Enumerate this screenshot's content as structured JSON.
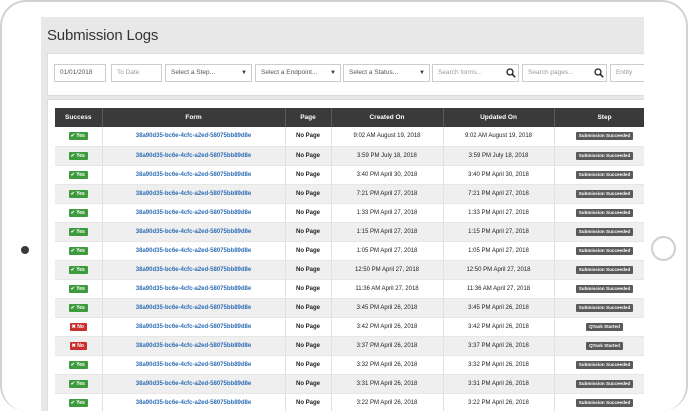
{
  "title": "Submission Logs",
  "filters": {
    "from_date": "01/01/2018",
    "to_date_placeholder": "To Date",
    "step_select": "Select a Step...",
    "endpoint_select": "Select a Endpoint...",
    "status_select": "Select a Status...",
    "search_forms_placeholder": "Search forms...",
    "search_pages_placeholder": "Search pages...",
    "entity_placeholder": "Entity"
  },
  "table": {
    "columns": [
      "Success",
      "Form",
      "Page",
      "Created On",
      "Updated On",
      "Step"
    ],
    "rows": [
      {
        "success": "Yes",
        "form": "38a90d35-bc6e-4cfc-a2ed-58075bb89d8e",
        "page": "No Page",
        "created": "9:02 AM August 19, 2018",
        "updated": "9:02 AM August 19, 2018",
        "step": "Submission Succeeded"
      },
      {
        "success": "Yes",
        "form": "38a90d35-bc6e-4cfc-a2ed-58075bb89d8e",
        "page": "No Page",
        "created": "3:59 PM July 18, 2018",
        "updated": "3:59 PM July 18, 2018",
        "step": "Submission Succeeded"
      },
      {
        "success": "Yes",
        "form": "38a90d35-bc6e-4cfc-a2ed-58075bb89d8e",
        "page": "No Page",
        "created": "3:40 PM April 30, 2018",
        "updated": "3:40 PM April 30, 2018",
        "step": "Submission Succeeded"
      },
      {
        "success": "Yes",
        "form": "38a90d35-bc6e-4cfc-a2ed-58075bb89d8e",
        "page": "No Page",
        "created": "7:21 PM April 27, 2018",
        "updated": "7:21 PM April 27, 2018",
        "step": "Submission Succeeded"
      },
      {
        "success": "Yes",
        "form": "38a90d35-bc6e-4cfc-a2ed-58075bb89d8e",
        "page": "No Page",
        "created": "1:33 PM April 27, 2018",
        "updated": "1:33 PM April 27, 2018",
        "step": "Submission Succeeded"
      },
      {
        "success": "Yes",
        "form": "38a90d35-bc6e-4cfc-a2ed-58075bb89d8e",
        "page": "No Page",
        "created": "1:15 PM April 27, 2018",
        "updated": "1:15 PM April 27, 2018",
        "step": "Submission Succeeded"
      },
      {
        "success": "Yes",
        "form": "38a90d35-bc6e-4cfc-a2ed-58075bb89d8e",
        "page": "No Page",
        "created": "1:05 PM April 27, 2018",
        "updated": "1:05 PM April 27, 2018",
        "step": "Submission Succeeded"
      },
      {
        "success": "Yes",
        "form": "38a90d35-bc6e-4cfc-a2ed-58075bb89d8e",
        "page": "No Page",
        "created": "12:50 PM April 27, 2018",
        "updated": "12:50 PM April 27, 2018",
        "step": "Submission Succeeded"
      },
      {
        "success": "Yes",
        "form": "38a90d35-bc6e-4cfc-a2ed-58075bb89d8e",
        "page": "No Page",
        "created": "11:36 AM April 27, 2018",
        "updated": "11:36 AM April 27, 2018",
        "step": "Submission Succeeded"
      },
      {
        "success": "Yes",
        "form": "38a90d35-bc6e-4cfc-a2ed-58075bb89d8e",
        "page": "No Page",
        "created": "3:45 PM April 26, 2018",
        "updated": "3:45 PM April 26, 2018",
        "step": "Submission Succeeded"
      },
      {
        "success": "No",
        "form": "38a90d35-bc6e-4cfc-a2ed-58075bb89d8e",
        "page": "No Page",
        "created": "3:42 PM April 26, 2018",
        "updated": "3:42 PM April 26, 2018",
        "step": "QTask Started"
      },
      {
        "success": "No",
        "form": "38a90d35-bc6e-4cfc-a2ed-58075bb89d8e",
        "page": "No Page",
        "created": "3:37 PM April 26, 2018",
        "updated": "3:37 PM April 26, 2018",
        "step": "QTask Started"
      },
      {
        "success": "Yes",
        "form": "38a90d35-bc6e-4cfc-a2ed-58075bb89d8e",
        "page": "No Page",
        "created": "3:32 PM April 26, 2018",
        "updated": "3:32 PM April 26, 2018",
        "step": "Submission Succeeded"
      },
      {
        "success": "Yes",
        "form": "38a90d35-bc6e-4cfc-a2ed-58075bb89d8e",
        "page": "No Page",
        "created": "3:31 PM April 26, 2018",
        "updated": "3:31 PM April 26, 2018",
        "step": "Submission Succeeded"
      },
      {
        "success": "Yes",
        "form": "38a90d35-bc6e-4cfc-a2ed-58075bb89d8e",
        "page": "No Page",
        "created": "3:22 PM April 26, 2018",
        "updated": "3:22 PM April 26, 2018",
        "step": "Submission Succeeded"
      }
    ]
  },
  "icons": {
    "yes": "check-icon",
    "no": "x-icon",
    "dropdown": "caret-down-icon",
    "search": "search-icon"
  },
  "colors": {
    "header_bg": "#3a3a3a",
    "success_green": "#3d9a3d",
    "fail_red": "#c9302c",
    "link_blue": "#2f6fb5",
    "step_badge": "#5a5a5a"
  }
}
